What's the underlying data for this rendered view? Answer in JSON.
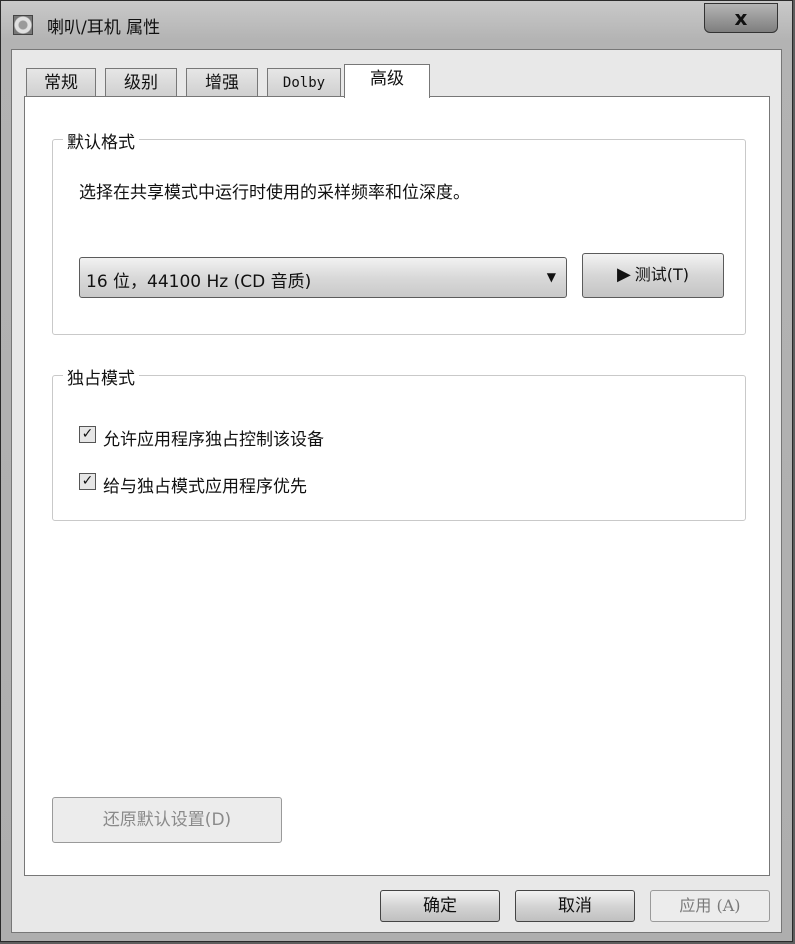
{
  "window": {
    "title": "喇叭/耳机 属性",
    "close_label": "x"
  },
  "tabs": [
    {
      "label": "常规",
      "active": false
    },
    {
      "label": "级别",
      "active": false
    },
    {
      "label": "增强",
      "active": false
    },
    {
      "label": "Dolby",
      "active": false
    },
    {
      "label": "高级",
      "active": true
    }
  ],
  "default_format": {
    "title": "默认格式",
    "description": "选择在共享模式中运行时使用的采样频率和位深度。",
    "selected_format": "16 位，44100 Hz (CD 音质)",
    "test_button_label": "测试(T)"
  },
  "exclusive_mode": {
    "title": "独占模式",
    "options": [
      {
        "label": "允许应用程序独占控制该设备",
        "checked": true
      },
      {
        "label": "给与独占模式应用程序优先",
        "checked": true
      }
    ]
  },
  "restore_defaults_label": "还原默认设置(D)",
  "buttons": {
    "ok": "确定",
    "cancel": "取消",
    "apply": "应用 (A)"
  }
}
